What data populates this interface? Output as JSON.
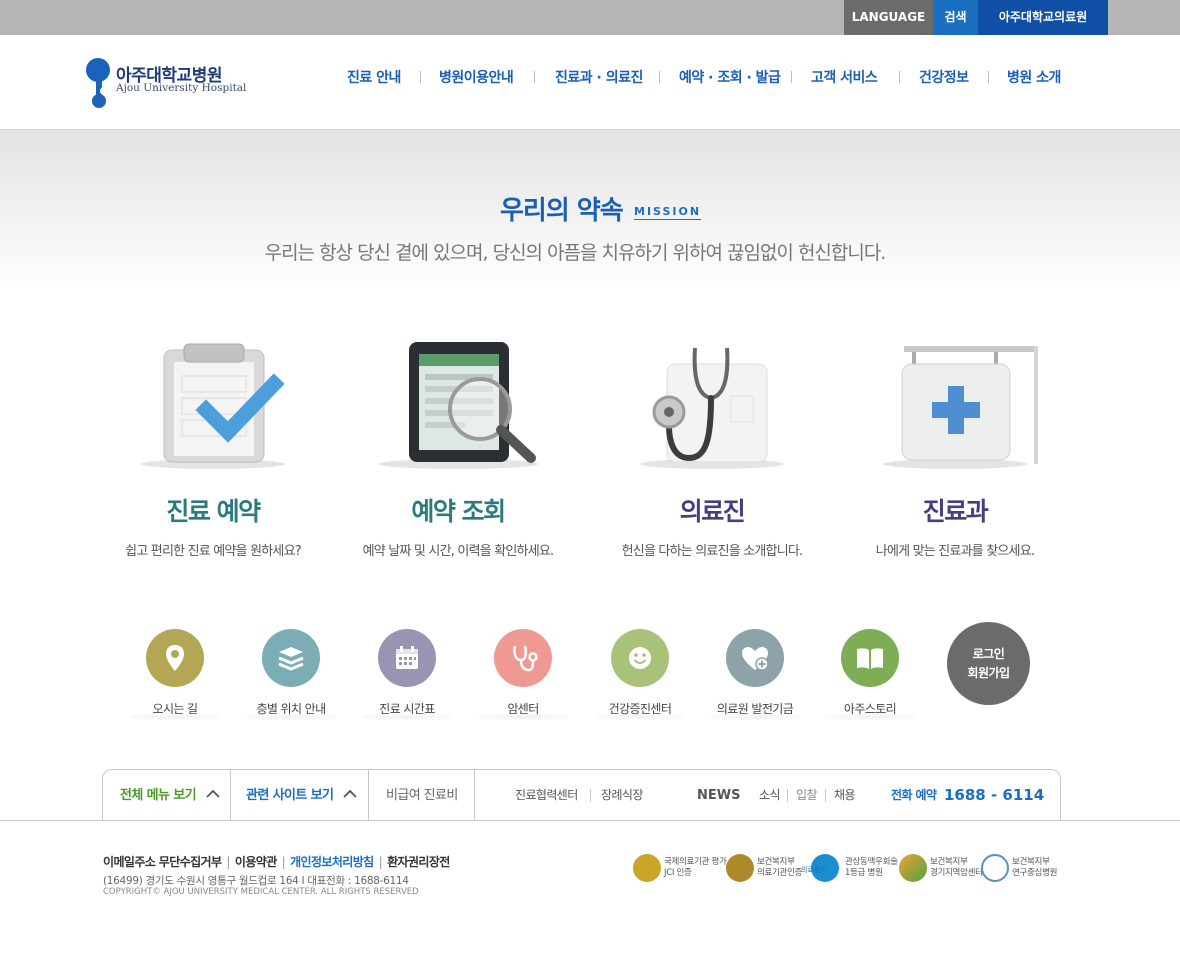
{
  "topbar": {
    "language": "LANGUAGE",
    "search": "검색",
    "hospital": "아주대학교의료원"
  },
  "header": {
    "logo_ko": "아주대학교병원",
    "logo_en": "Ajou University Hospital",
    "nav": [
      "진료 안내",
      "병원이용안내",
      "진료과 · 의료진",
      "예약 · 조회 · 발급",
      "고객 서비스",
      "건강정보",
      "병원 소개"
    ]
  },
  "mission": {
    "title": "우리의 약속",
    "tag": "MISSION",
    "subtitle": "우리는 항상 당신 곁에 있으며, 당신의 아픔을 치유하기 위하여 끊임없이 헌신합니다."
  },
  "services": [
    {
      "title": "진료 예약",
      "desc": "쉽고 편리한 진료 예약을 원하세요?",
      "color": "#2b7a7e",
      "icon": "clipboard-check-icon"
    },
    {
      "title": "예약 조회",
      "desc": "예약 날짜 및 시간, 이력을 확인하세요.",
      "color": "#2b7a7e",
      "icon": "tablet-magnifier-icon"
    },
    {
      "title": "의료진",
      "desc": "헌신을 다하는 의료진을 소개합니다.",
      "color": "#4a3d7e",
      "icon": "stethoscope-icon"
    },
    {
      "title": "진료과",
      "desc": "나에게 맞는 진료과를 찾으세요.",
      "color": "#4a3d7e",
      "icon": "hospital-sign-icon"
    }
  ],
  "quick": [
    {
      "label": "오시는 길",
      "color": "#b3a755",
      "icon": "map-pin-icon"
    },
    {
      "label": "층별 위치 안내",
      "color": "#7aaeb4",
      "icon": "layers-icon"
    },
    {
      "label": "진료 시간표",
      "color": "#9a94b2",
      "icon": "calendar-icon"
    },
    {
      "label": "암센터",
      "color": "#ee9a93",
      "icon": "stethoscope-icon"
    },
    {
      "label": "건강증진센터",
      "color": "#a8c27a",
      "icon": "smile-icon"
    },
    {
      "label": "의료원 발전기금",
      "color": "#8ea2aa",
      "icon": "heart-plus-icon"
    },
    {
      "label": "아주스토리",
      "color": "#7fad55",
      "icon": "book-icon"
    }
  ],
  "login": {
    "line1": "로그인",
    "line2": "회원가입"
  },
  "footerbar": {
    "all_menu": "전체 메뉴 보기",
    "related_sites": "관련 사이트 보기",
    "non_covered": "비급여 진료비",
    "partner_center": "진료협력센터",
    "funeral": "장례식장",
    "news": "NEWS",
    "news_items": [
      "소식",
      "입찰",
      "채용"
    ],
    "phone_label": "전화 예약",
    "phone_number": "1688 - 6114"
  },
  "footer": {
    "links": [
      "이메일주소 무단수집거부",
      "이용약관",
      "개인정보처리방침",
      "환자권리장전"
    ],
    "address": "(16499)  경기도 수원시 영통구 월드컵로 164    I    대표전화 : 1688-6114",
    "copyright": "COPYRIGHT© AJOU UNIVERSITY MEDICAL CENTER. ALL RIGHTS RESERVED",
    "certs": [
      {
        "line1": "국제의료기관 평가",
        "line2": "JCI 인증",
        "color": "#c9a52a"
      },
      {
        "line1": "보건복지부",
        "line2": "의료기관인증",
        "color": "#b08a2a"
      },
      {
        "line1": "관상동맥우회술",
        "line2": "1등급 병원",
        "color": "#1a8fd0",
        "badge": "의료평가"
      },
      {
        "line1": "보건복지부",
        "line2": "경기지역암센터",
        "color": "#e07a2a"
      },
      {
        "line1": "보건복지부",
        "line2": "연구중심병원",
        "color": "#5a8fc0"
      }
    ]
  }
}
